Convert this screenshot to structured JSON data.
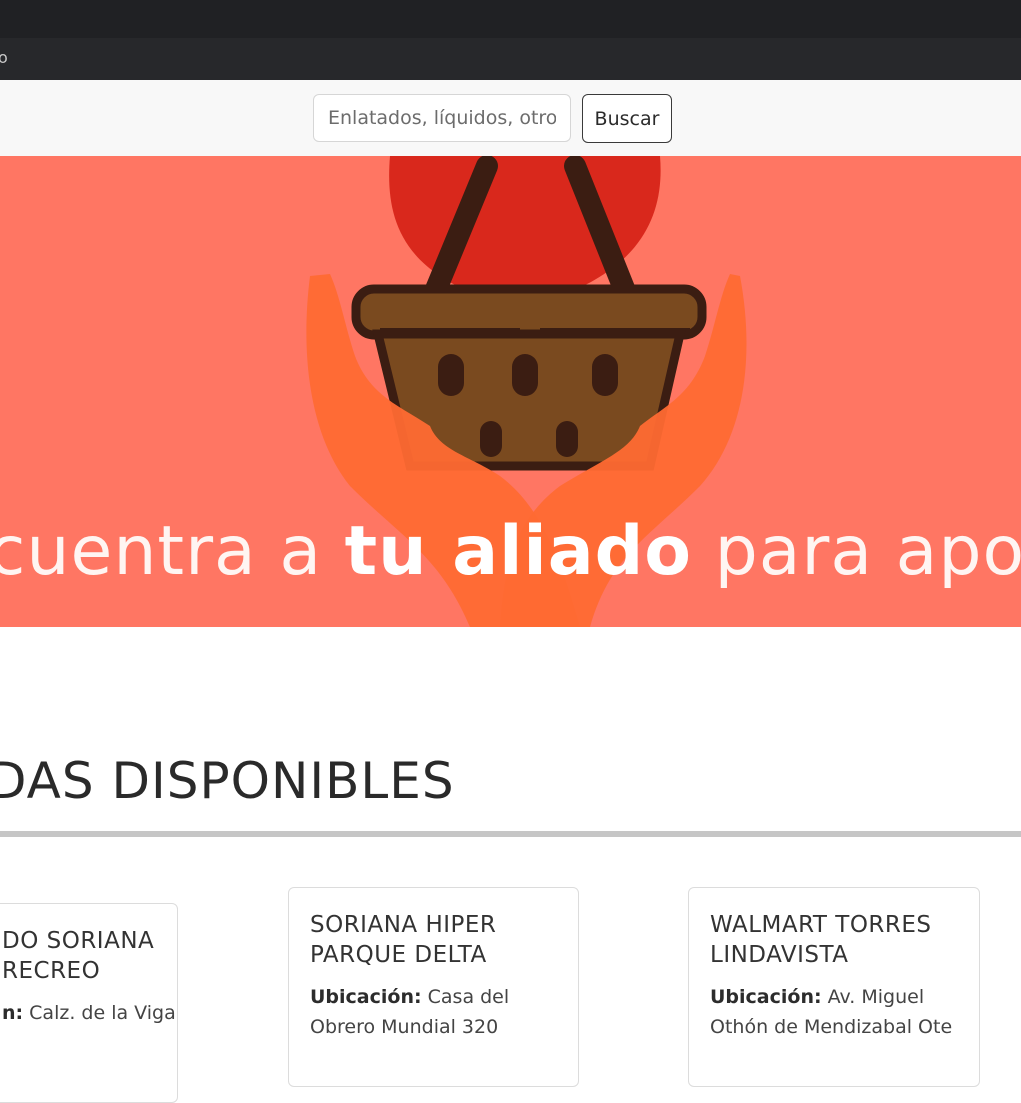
{
  "browser": {
    "address_fragment": "o"
  },
  "search": {
    "placeholder": "Enlatados, líquidos, otro",
    "button_label": "Buscar"
  },
  "hero": {
    "text_before": "cuentra a ",
    "text_bold": "tu aliado",
    "text_after": " para apo"
  },
  "section": {
    "title": "DAS DISPONIBLES"
  },
  "colors": {
    "hero_bg": "#ff7663",
    "heart": "#d9281c",
    "basket": "#7a4a1f",
    "hands": "#ff6a33"
  },
  "cards": [
    {
      "title": "DO SORIANA\nRECREO",
      "loc_label": "n:",
      "loc_value": " Calz. de la Viga"
    },
    {
      "title": "SORIANA HIPER\nPARQUE DELTA",
      "loc_label": "Ubicación:",
      "loc_value": " Casa del Obrero Mundial 320"
    },
    {
      "title": "WALMART TORRES\nLINDAVISTA",
      "loc_label": "Ubicación:",
      "loc_value": " Av. Miguel Othón de Mendizabal Ote"
    }
  ]
}
